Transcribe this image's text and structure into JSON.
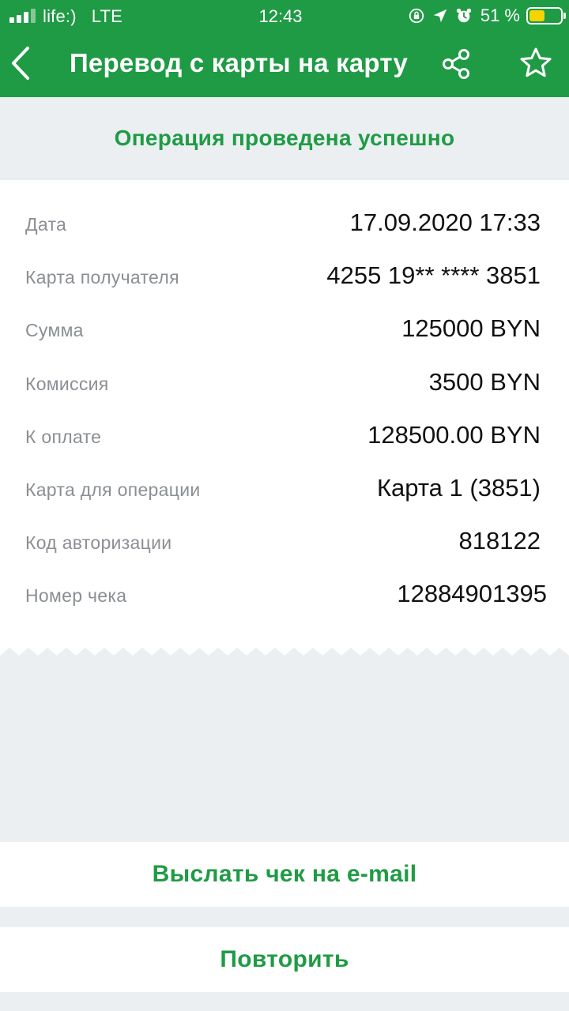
{
  "colors": {
    "brand_green": "#1f9b45",
    "background": "#ebeff2",
    "label_gray": "#8b8f94",
    "battery_yellow": "#f5d400"
  },
  "status_bar": {
    "carrier": "life:)",
    "network": "LTE",
    "time": "12:43",
    "battery_percent": "51 %",
    "battery_level": 0.51,
    "icons": [
      "signal-icon",
      "orientation-lock-icon",
      "location-arrow-icon",
      "alarm-icon",
      "battery-icon"
    ]
  },
  "nav": {
    "title": "Перевод с карты на карту",
    "back_icon": "chevron-left-icon",
    "share_icon": "share-icon",
    "favorite_icon": "star-icon"
  },
  "banner": {
    "message": "Операция проведена успешно"
  },
  "details": [
    {
      "label": "Дата",
      "value": "17.09.2020 17:33"
    },
    {
      "label": "Карта получателя",
      "value": "4255 19** **** 3851"
    },
    {
      "label": "Сумма",
      "value": "125000 BYN"
    },
    {
      "label": "Комиссия",
      "value": "3500 BYN"
    },
    {
      "label": "К оплате",
      "value": "128500.00 BYN"
    },
    {
      "label": "Карта для операции",
      "value": "Карта 1 (3851)"
    },
    {
      "label": "Код авторизации",
      "value": "818122"
    },
    {
      "label": "Номер чека",
      "value": "12884901395"
    }
  ],
  "actions": {
    "send_receipt": "Выслать чек на e-mail",
    "repeat": "Повторить"
  }
}
